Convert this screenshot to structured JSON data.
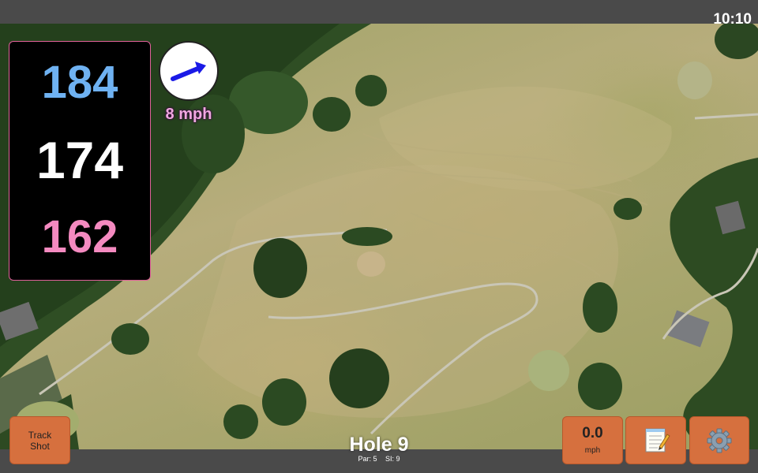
{
  "status_bar": {
    "time": "10:10"
  },
  "distances": {
    "back": "184",
    "middle": "174",
    "front": "162"
  },
  "wind": {
    "speed": "8 mph",
    "arrow_color": "#1a1ae6"
  },
  "hole": {
    "title": "Hole 9",
    "par": "Par: 5",
    "stroke_index": "SI: 9"
  },
  "buttons": {
    "track_shot": {
      "label": "Track\nShot"
    },
    "speed": {
      "value": "0.0",
      "unit": "mph"
    },
    "notes": {
      "icon": "notepad-icon"
    },
    "settings": {
      "icon": "gear-icon"
    }
  },
  "colors": {
    "back_distance": "#6fb2f2",
    "middle_distance": "#ffffff",
    "front_distance": "#f48ac0",
    "button_bg": "#d6703e"
  }
}
